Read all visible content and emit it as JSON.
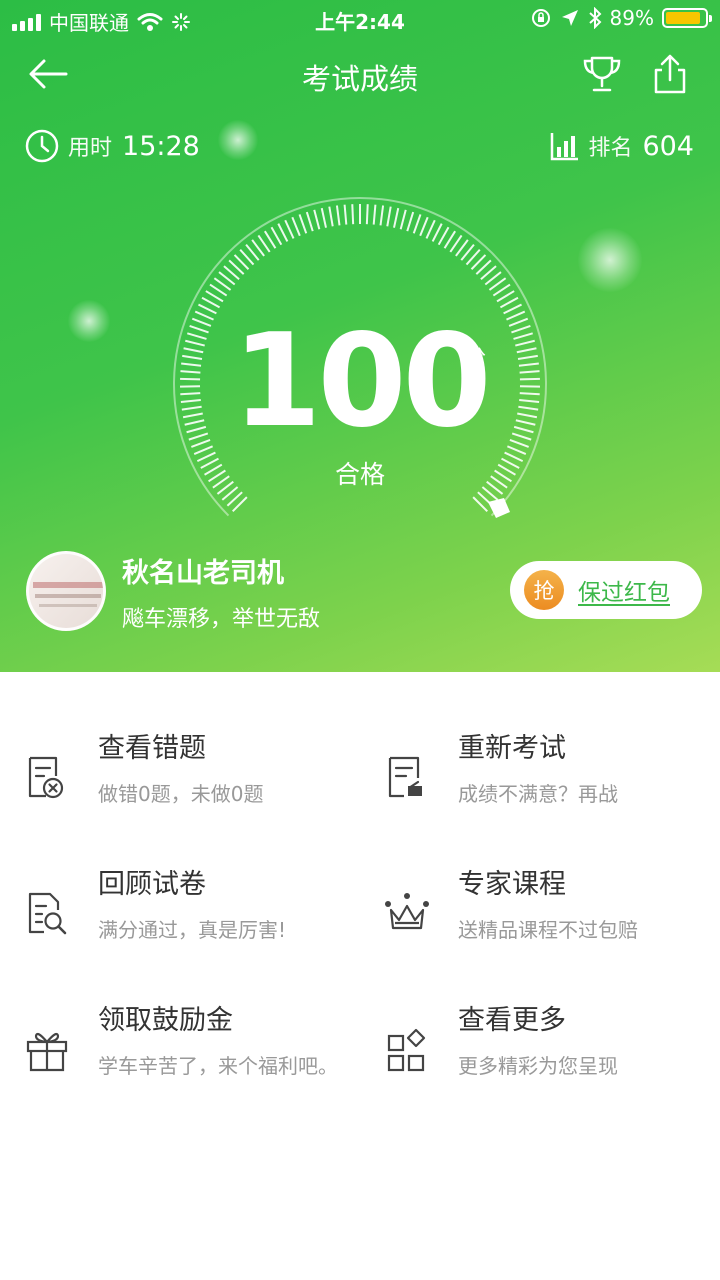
{
  "status_bar": {
    "carrier": "中国联通",
    "time": "上午2:44",
    "battery_percent": "89%",
    "battery_level": 0.89,
    "battery_color": "#f7c600"
  },
  "nav": {
    "title": "考试成绩",
    "back_icon": "arrow-left-icon",
    "trophy_icon": "trophy-icon",
    "share_icon": "share-icon"
  },
  "stats": {
    "time_label": "用时",
    "time_value": "15:28",
    "rank_label": "排名",
    "rank_value": "604"
  },
  "result": {
    "score": "100",
    "unit": "分",
    "status": "合格",
    "gauge_fraction": 1.0
  },
  "user": {
    "name": "秋名山老司机",
    "motto": "飚车漂移，举世无敌"
  },
  "reward_button": {
    "badge": "抢",
    "label": "保过红包"
  },
  "actions": [
    {
      "title": "查看错题",
      "subtitle": "做错0题，未做0题",
      "icon": "wrong-answers-icon"
    },
    {
      "title": "重新考试",
      "subtitle": "成绩不满意？再战",
      "icon": "retake-exam-icon"
    },
    {
      "title": "回顾试卷",
      "subtitle": "满分通过，真是厉害!",
      "icon": "review-paper-icon"
    },
    {
      "title": "专家课程",
      "subtitle": "送精品课程不过包赔",
      "icon": "crown-icon"
    },
    {
      "title": "领取鼓励金",
      "subtitle": "学车辛苦了，来个福利吧。",
      "icon": "gift-icon"
    },
    {
      "title": "查看更多",
      "subtitle": "更多精彩为您呈现",
      "icon": "more-grid-icon"
    }
  ],
  "colors": {
    "brand_green": "#2cbd45",
    "link_green": "#3db84a",
    "badge_orange": "#ec8c22"
  }
}
